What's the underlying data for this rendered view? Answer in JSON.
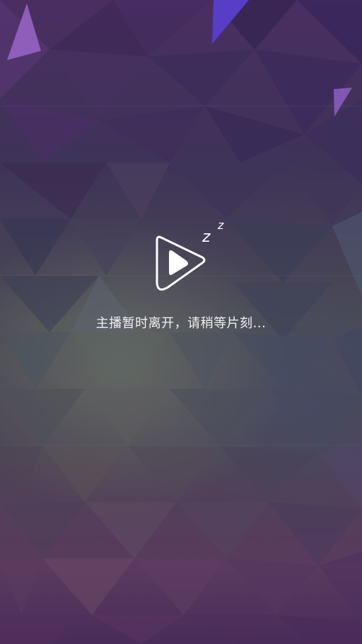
{
  "screen": {
    "status_message": "主播暂时离开，请稍等片刻...",
    "sleep_marks": [
      "z",
      "z"
    ]
  },
  "colors": {
    "background_top": "#4a2e62",
    "background_mid": "#4a4a55",
    "background_bottom": "#4a2c5a",
    "accent_purple": "#8e5bc2",
    "accent_blue": "#5b3ecb",
    "text": "#f2f0f4"
  },
  "icons": {
    "logo": "play-triangle-icon",
    "sleep": "zz-sleep-icon"
  }
}
